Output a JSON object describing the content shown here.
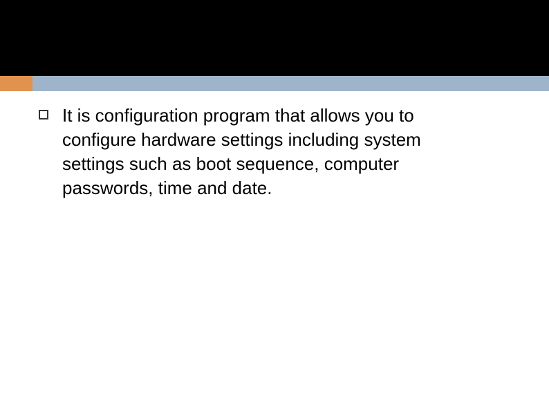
{
  "colors": {
    "orange": "#e2924f",
    "blue": "#9eb4cb",
    "black": "#000000"
  },
  "bullets": [
    {
      "text": "It is configuration program that allows you to configure hardware settings including system settings such as boot sequence, computer passwords, time and date."
    }
  ]
}
